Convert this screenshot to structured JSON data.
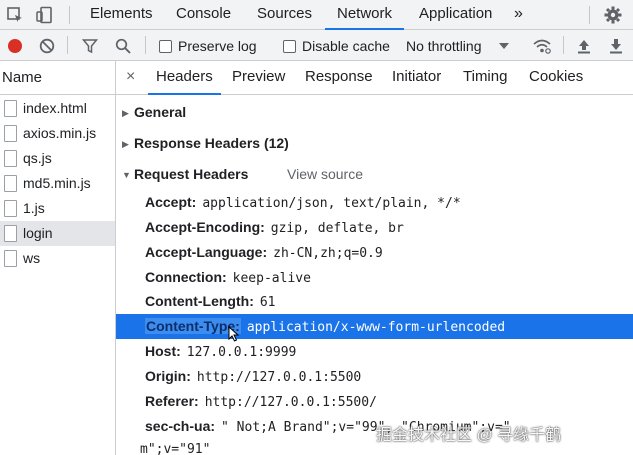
{
  "top_tabs": [
    "Elements",
    "Console",
    "Sources",
    "Network",
    "Application"
  ],
  "more_tabs_icon": "»",
  "toolbar": {
    "preserve_log": "Preserve log",
    "disable_cache": "Disable cache",
    "throttling": "No throttling"
  },
  "left": {
    "header": "Name",
    "items": [
      "index.html",
      "axios.min.js",
      "qs.js",
      "md5.min.js",
      "1.js",
      "login",
      "ws"
    ]
  },
  "detail_tabs": {
    "close": "×",
    "tabs": [
      "Headers",
      "Preview",
      "Response",
      "Initiator",
      "Timing",
      "Cookies"
    ]
  },
  "sections": {
    "general": "General",
    "response_headers": "Response Headers (12)",
    "request_headers": "Request Headers",
    "view_source": "View source"
  },
  "request_headers": [
    {
      "name": "Accept:",
      "value": "application/json, text/plain, */*"
    },
    {
      "name": "Accept-Encoding:",
      "value": "gzip, deflate, br"
    },
    {
      "name": "Accept-Language:",
      "value": "zh-CN,zh;q=0.9"
    },
    {
      "name": "Connection:",
      "value": "keep-alive"
    },
    {
      "name": "Content-Length:",
      "value": "61"
    },
    {
      "name": "Content-Type:",
      "value": "application/x-www-form-urlencoded"
    },
    {
      "name": "Host:",
      "value": "127.0.0.1:9999"
    },
    {
      "name": "Origin:",
      "value": "http://127.0.0.1:5500"
    },
    {
      "name": "Referer:",
      "value": "http://127.0.0.1:5500/"
    },
    {
      "name": "sec-ch-ua:",
      "value": "\" Not;A Brand\";v=\"99\", \"Chromium\";v=\""
    },
    {
      "name": "",
      "value": "m\";v=\"91\""
    }
  ],
  "watermark": "掘金技术社区 @ 寻缘千鹤",
  "colors": {
    "accent": "#1a73e8",
    "record_red": "#d93025",
    "selected_row": "#1a73e8"
  }
}
